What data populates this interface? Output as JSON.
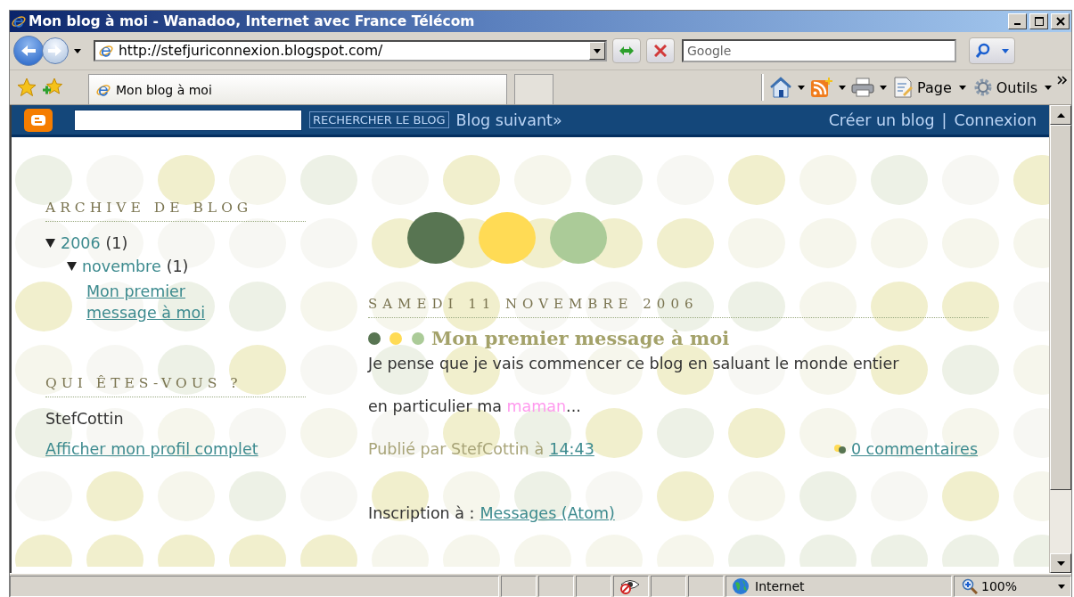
{
  "window": {
    "title": "Mon blog à moi - Wanadoo, Internet avec France Télécom"
  },
  "address_bar": {
    "url": "http://stefjuriconnexion.blogspot.com/"
  },
  "search": {
    "placeholder": "Google"
  },
  "tabs": [
    {
      "label": "Mon blog à moi",
      "selected": true
    }
  ],
  "toolbar": {
    "page": "Page",
    "tools": "Outils"
  },
  "blogger_bar": {
    "search_button": "RECHERCHER LE BLOG",
    "next_blog": "Blog suivant»",
    "links": [
      {
        "label": "Créer un blog"
      },
      {
        "label": "Connexion"
      }
    ],
    "separator": "|"
  },
  "archive": {
    "title": "ARCHIVE DE BLOG",
    "tree": [
      {
        "label": "2006",
        "count": "(1)",
        "expanded": true,
        "children": [
          {
            "label": "novembre",
            "count": "(1)",
            "expanded": true,
            "children": [
              {
                "label": "Mon premier message à moi"
              }
            ]
          }
        ]
      }
    ]
  },
  "profile": {
    "title": "QUI ÊTES-VOUS ?",
    "name": "StefCottin",
    "link": "Afficher mon profil complet"
  },
  "post": {
    "date": "SAMEDI 11 NOVEMBRE 2006",
    "title": "Mon premier message à moi",
    "paragraphs": [
      [
        {
          "text": "Je pense que je vais commencer ce blog en saluant le monde entier",
          "kind": "plain"
        }
      ],
      [
        {
          "text": "en particulier ma ",
          "kind": "plain"
        },
        {
          "text": "maman",
          "kind": "highlight"
        },
        {
          "text": "...",
          "kind": "plain"
        }
      ]
    ],
    "byline": "Publié par StefCottin",
    "at": "à",
    "time": "14:43",
    "comments": "0 commentaires"
  },
  "subscribe": {
    "label": "Inscription à :",
    "link": "Messages (Atom)"
  },
  "status_bar": {
    "zone": "Internet",
    "zoom": "100%"
  }
}
